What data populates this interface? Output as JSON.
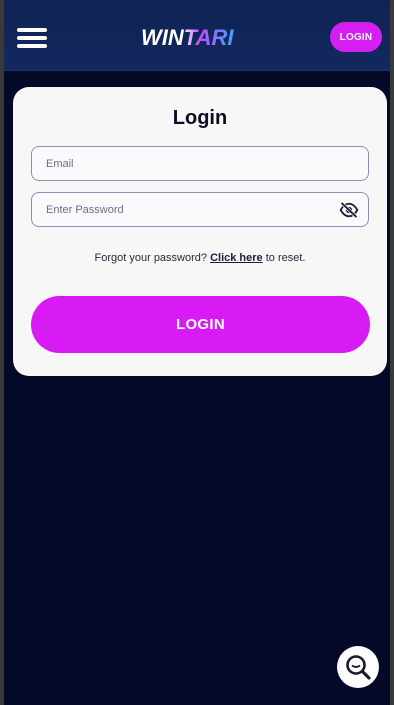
{
  "header": {
    "logo_text": "WINTARI",
    "login_label": "LOGIN",
    "menu_icon": "hamburger-menu-icon"
  },
  "login_card": {
    "title": "Login",
    "email_placeholder": "Email",
    "password_placeholder": "Enter Password",
    "password_toggle_icon": "eye-slash-icon",
    "forgot_prefix": "Forgot your password?",
    "forgot_link": "Click here",
    "forgot_suffix": "to reset.",
    "submit_label": "LOGIN"
  },
  "chat_widget": {
    "icon": "chat-search-icon"
  },
  "colors": {
    "background": "#050928",
    "header": "#13285d",
    "accent": "#d81af5",
    "card": "#f7f7f8"
  }
}
